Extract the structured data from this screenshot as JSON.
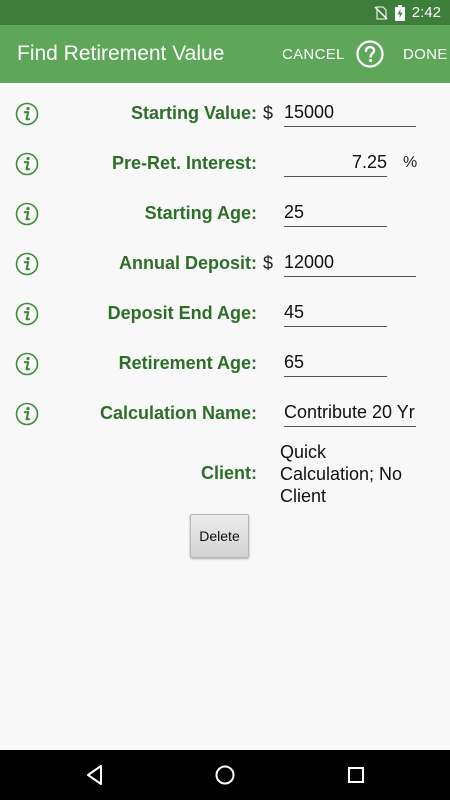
{
  "status_bar": {
    "time": "2:42",
    "icons": [
      "no-sim-icon",
      "battery-charging-icon"
    ]
  },
  "app_bar": {
    "title": "Find Retirement Value",
    "cancel_label": "CANCEL",
    "help_icon": "help-circle-icon",
    "done_label": "DONE"
  },
  "form": {
    "starting_value": {
      "label": "Starting Value:",
      "currency": "$",
      "value": "15000"
    },
    "pre_ret_interest": {
      "label": "Pre-Ret. Interest:",
      "value": "7.25",
      "unit": "%"
    },
    "starting_age": {
      "label": "Starting Age:",
      "value": "25"
    },
    "annual_deposit": {
      "label": "Annual Deposit:",
      "currency": "$",
      "value": "12000"
    },
    "deposit_end_age": {
      "label": "Deposit End Age:",
      "value": "45"
    },
    "retirement_age": {
      "label": "Retirement Age:",
      "value": "65"
    },
    "calculation_name": {
      "label": "Calculation Name:",
      "value": "Contribute 20 Yr"
    },
    "client": {
      "label": "Client:",
      "value": "Quick Calculation; No Client"
    }
  },
  "delete_label": "Delete",
  "colors": {
    "status_bar": "#3f7d3b",
    "app_bar": "#5ea65a",
    "label_green": "#2d6e29",
    "background": "#f8f8f8"
  }
}
